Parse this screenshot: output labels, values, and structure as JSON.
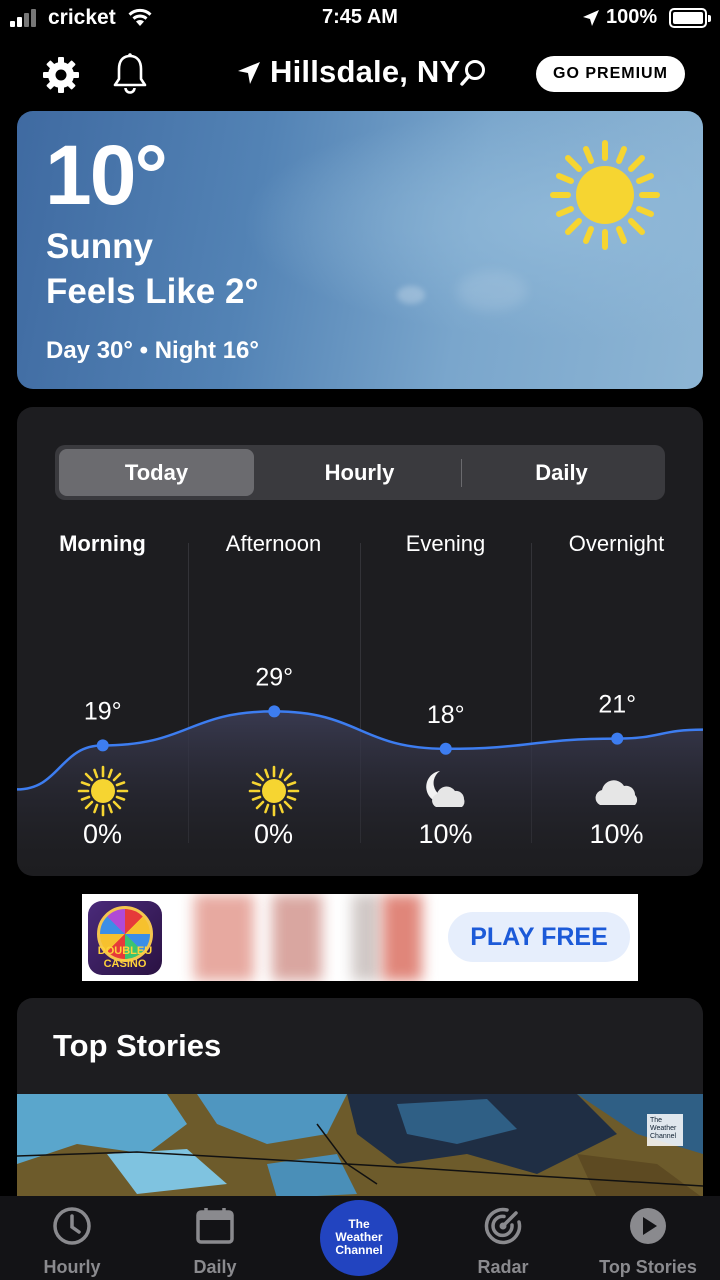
{
  "status_bar": {
    "carrier": "cricket",
    "time": "7:45 AM",
    "battery": "100%"
  },
  "header": {
    "location": "Hillsdale, NY",
    "premium_label": "GO PREMIUM"
  },
  "current": {
    "temperature": "10°",
    "condition": "Sunny",
    "feels_like": "Feels Like 2°",
    "day_night": "Day 30° • Night 16°"
  },
  "forecast": {
    "tabs": [
      {
        "label": "Today",
        "active": true
      },
      {
        "label": "Hourly",
        "active": false
      },
      {
        "label": "Daily",
        "active": false
      }
    ],
    "periods": [
      {
        "name": "Morning",
        "temp": "19°",
        "temp_value": 19,
        "icon": "sun-icon",
        "precip": "0%"
      },
      {
        "name": "Afternoon",
        "temp": "29°",
        "temp_value": 29,
        "icon": "sun-icon",
        "precip": "0%"
      },
      {
        "name": "Evening",
        "temp": "18°",
        "temp_value": 18,
        "icon": "moon-cloud-icon",
        "precip": "10%"
      },
      {
        "name": "Overnight",
        "temp": "21°",
        "temp_value": 21,
        "icon": "cloud-icon",
        "precip": "10%"
      }
    ]
  },
  "ad": {
    "logo_line1": "DOUBLEU",
    "logo_line2": "CASINO",
    "cta": "PLAY FREE"
  },
  "top_stories": {
    "title": "Top Stories",
    "badge": "The Weather Channel"
  },
  "tabbar": {
    "items": [
      {
        "label": "Hourly"
      },
      {
        "label": "Daily"
      },
      {
        "label": "Radar"
      },
      {
        "label": "Top Stories"
      }
    ],
    "center_line1": "The",
    "center_line2": "Weather",
    "center_line3": "Channel"
  },
  "colors": {
    "accent_blue": "#3d7df0",
    "card_bg": "#1d1d20",
    "sun_yellow": "#f6d531"
  }
}
